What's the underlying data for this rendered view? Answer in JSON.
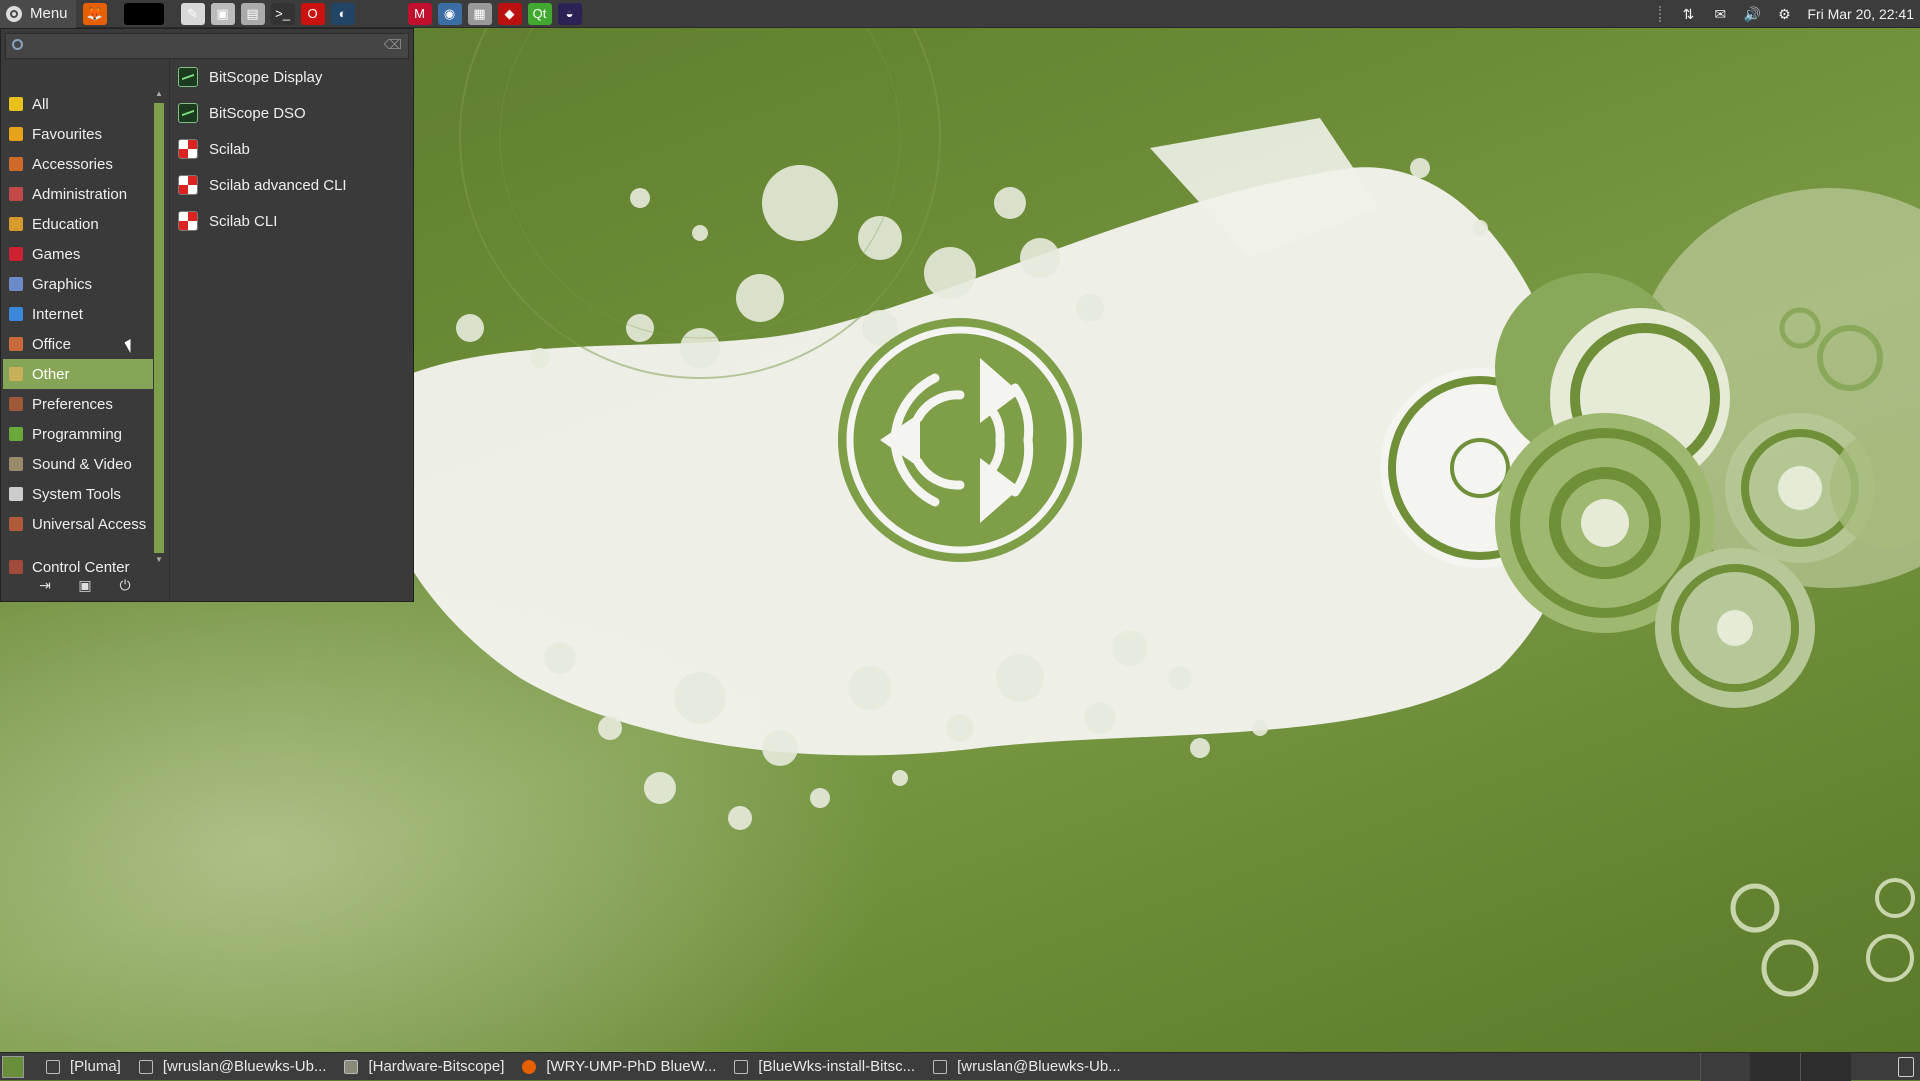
{
  "top_panel": {
    "menu_label": "Menu",
    "launchers": [
      {
        "name": "firefox-icon",
        "glyph": "🦊",
        "color": "#e66000"
      },
      {
        "name": "terminal-black-icon",
        "glyph": "",
        "color": "#000000"
      },
      {
        "name": "text-editor-icon",
        "glyph": "✎",
        "color": "#d8d8d8"
      },
      {
        "name": "screenshot-icon",
        "glyph": "▣",
        "color": "#bbbbbb"
      },
      {
        "name": "printer-icon",
        "glyph": "▤",
        "color": "#aaaaaa"
      },
      {
        "name": "terminal-icon",
        "glyph": ">_",
        "color": "#333333"
      },
      {
        "name": "opera-icon",
        "glyph": "O",
        "color": "#cc1111"
      },
      {
        "name": "bitscope-icon",
        "glyph": "◐",
        "color": "#224466"
      },
      {
        "name": "mendeley-icon",
        "glyph": "M",
        "color": "#c0102e"
      },
      {
        "name": "remote-desktop-icon",
        "glyph": "◉",
        "color": "#3a6ea5"
      },
      {
        "name": "spreadsheet-icon",
        "glyph": "▦",
        "color": "#999999"
      },
      {
        "name": "scilab-icon",
        "glyph": "◆",
        "color": "#bb1111"
      },
      {
        "name": "qt-creator-icon",
        "glyph": "Qt",
        "color": "#41a930"
      },
      {
        "name": "eclipse-icon",
        "glyph": "◒",
        "color": "#2c2255"
      }
    ],
    "tray": {
      "network": "⇅",
      "mail": "✉",
      "volume": "🔊",
      "settings": "⚙",
      "clock": "Fri Mar 20, 22:41"
    }
  },
  "app_menu": {
    "search": {
      "value": "",
      "placeholder": ""
    },
    "categories": [
      {
        "label": "All",
        "color": "#e8c21a"
      },
      {
        "label": "Favourites",
        "color": "#e8a21a"
      },
      {
        "label": "Accessories",
        "color": "#d06a2a"
      },
      {
        "label": "Administration",
        "color": "#c44a4a"
      },
      {
        "label": "Education",
        "color": "#d89a2a"
      },
      {
        "label": "Games",
        "color": "#cc2233"
      },
      {
        "label": "Graphics",
        "color": "#6a8ac8"
      },
      {
        "label": "Internet",
        "color": "#3a88d8"
      },
      {
        "label": "Office",
        "color": "#c86a3a"
      },
      {
        "label": "Other",
        "color": "#c8b05a"
      },
      {
        "label": "Preferences",
        "color": "#a05a3a"
      },
      {
        "label": "Programming",
        "color": "#6aa83a"
      },
      {
        "label": "Sound & Video",
        "color": "#9a8a6a"
      },
      {
        "label": "System Tools",
        "color": "#cccccc"
      },
      {
        "label": "Universal Access",
        "color": "#b05a3a"
      }
    ],
    "active_category": "Other",
    "control_center": {
      "label": "Control Center",
      "color": "#a04a3a"
    },
    "apps": [
      {
        "label": "BitScope Display",
        "icon": "bitscope-icon"
      },
      {
        "label": "BitScope DSO",
        "icon": "bitscope-icon"
      },
      {
        "label": "Scilab",
        "icon": "scilab-icon"
      },
      {
        "label": "Scilab advanced CLI",
        "icon": "scilab-icon"
      },
      {
        "label": "Scilab CLI",
        "icon": "scilab-icon"
      }
    ],
    "footer": {
      "logout": "⇥",
      "lock": "▣",
      "shutdown": "⏻"
    }
  },
  "bottom_panel": {
    "tasks": [
      {
        "label": "[Pluma]",
        "icon": "text-editor-icon"
      },
      {
        "label": "[wruslan@Bluewks-Ub...",
        "icon": "terminal-icon"
      },
      {
        "label": "[Hardware-Bitscope]",
        "icon": "folder-icon"
      },
      {
        "label": "[WRY-UMP-PhD BlueW...",
        "icon": "firefox-icon"
      },
      {
        "label": "[BlueWks-install-Bitsc...",
        "icon": "text-editor-icon"
      },
      {
        "label": "[wruslan@Bluewks-Ub...",
        "icon": "terminal-icon"
      }
    ]
  },
  "colors": {
    "accent": "#87a556",
    "panel": "#3c3c3c",
    "menu_bg": "#3a3a3a"
  }
}
